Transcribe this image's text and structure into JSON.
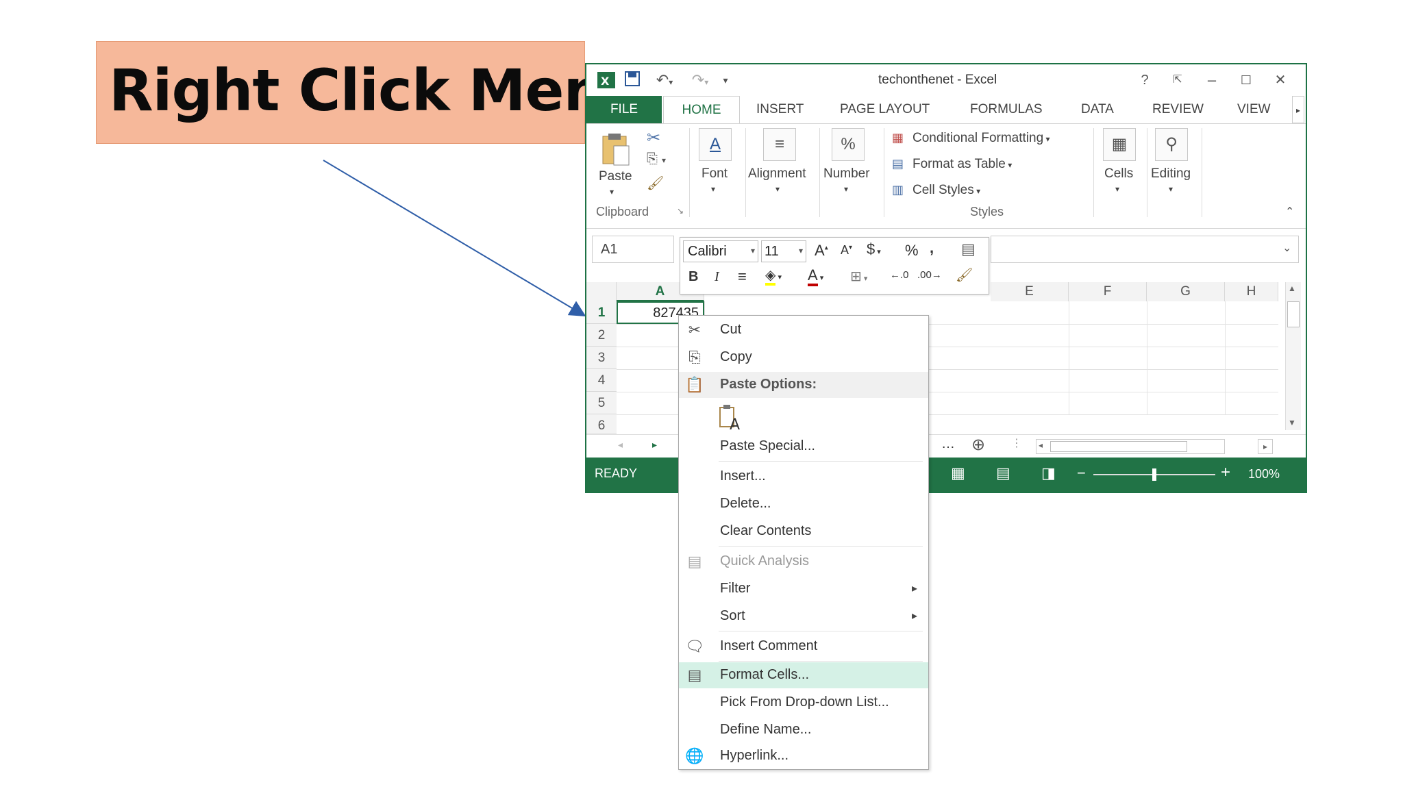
{
  "slide": {
    "title": "Right Click Menu"
  },
  "window": {
    "title": "techonthenet - Excel",
    "controls": {
      "help": "?",
      "minimize": "–",
      "close": "✕"
    }
  },
  "tabs": [
    "FILE",
    "HOME",
    "INSERT",
    "PAGE LAYOUT",
    "FORMULAS",
    "DATA",
    "REVIEW",
    "VIEW"
  ],
  "ribbon": {
    "clipboard": {
      "paste": "Paste",
      "group": "Clipboard"
    },
    "font": "Font",
    "alignment": "Alignment",
    "number": "Number",
    "styles": {
      "conditional": "Conditional Formatting",
      "format_table": "Format as Table",
      "cell_styles": "Cell Styles",
      "group": "Styles"
    },
    "cells": "Cells",
    "editing": "Editing"
  },
  "namebox": "A1",
  "mini_toolbar": {
    "font": "Calibri",
    "size": "11"
  },
  "grid": {
    "columns": [
      "A",
      "E",
      "F",
      "G",
      "H"
    ],
    "rows": [
      "1",
      "2",
      "3",
      "4",
      "5",
      "6"
    ],
    "a1_value": "827435"
  },
  "status": {
    "ready": "READY",
    "zoom": "100%"
  },
  "context_menu": {
    "cut": "Cut",
    "copy": "Copy",
    "paste_options": "Paste Options:",
    "paste_special": "Paste Special...",
    "insert": "Insert...",
    "delete": "Delete...",
    "clear_contents": "Clear Contents",
    "quick_analysis": "Quick Analysis",
    "filter": "Filter",
    "sort": "Sort",
    "insert_comment": "Insert Comment",
    "format_cells": "Format Cells...",
    "pick_list": "Pick From Drop-down List...",
    "define_name": "Define Name...",
    "hyperlink": "Hyperlink..."
  },
  "colors": {
    "excel_green": "#217346",
    "callout": "#f6b89a",
    "highlight": "#d5f1e6",
    "arrow": "#2f5ea8"
  }
}
